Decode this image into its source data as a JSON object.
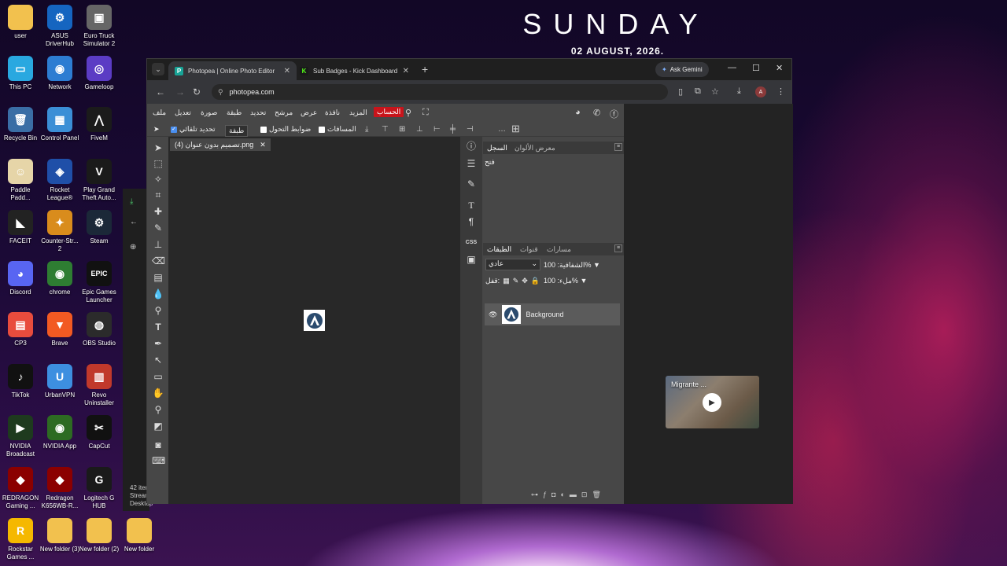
{
  "desktop": {
    "clock": {
      "day": "SUNDAY",
      "date": "02 AUGUST, 2026."
    },
    "icons": [
      {
        "label": "user",
        "color": "#f2c14e",
        "glyph": ""
      },
      {
        "label": "ASUS DriverHub",
        "color": "#1565c0",
        "glyph": "⚙"
      },
      {
        "label": "Euro Truck Simulator 2",
        "color": "#666666",
        "glyph": "▣"
      },
      {
        "label": "This PC",
        "color": "#29a8e0",
        "glyph": "▭"
      },
      {
        "label": "Network",
        "color": "#2d7dd2",
        "glyph": "◉"
      },
      {
        "label": "Gameloop",
        "color": "#5b3cc4",
        "glyph": "◎"
      },
      {
        "label": "Recycle Bin",
        "color": "#3a6ea5",
        "glyph": "🗑"
      },
      {
        "label": "Control Panel",
        "color": "#3b8fd6",
        "glyph": "▦"
      },
      {
        "label": "FiveM",
        "color": "#1b1b1b",
        "glyph": "⋀"
      },
      {
        "label": "Paddle Padd...",
        "color": "#e6d5a8",
        "glyph": "☺"
      },
      {
        "label": "Rocket League®",
        "color": "#1f4fa8",
        "glyph": "◈"
      },
      {
        "label": "Play Grand Theft Auto...",
        "color": "#1a1a1a",
        "glyph": "V"
      },
      {
        "label": "FACEIT",
        "color": "#222222",
        "glyph": "◣"
      },
      {
        "label": "Counter-Str... 2",
        "color": "#d98c1c",
        "glyph": "✦"
      },
      {
        "label": "Steam",
        "color": "#1b2838",
        "glyph": "⚙"
      },
      {
        "label": "Discord",
        "color": "#5865f2",
        "glyph": "◕"
      },
      {
        "label": "chrome",
        "color": "#2e7d32",
        "glyph": "◉"
      },
      {
        "label": "Epic Games Launcher",
        "color": "#111111",
        "glyph": "EPIC"
      },
      {
        "label": "CP3",
        "color": "#e84c3d",
        "glyph": "▤"
      },
      {
        "label": "Brave",
        "color": "#f25a22",
        "glyph": "▼"
      },
      {
        "label": "OBS Studio",
        "color": "#2b2b2b",
        "glyph": "◍"
      },
      {
        "label": "TikTok",
        "color": "#111111",
        "glyph": "♪"
      },
      {
        "label": "UrbanVPN",
        "color": "#3d8fe0",
        "glyph": "U"
      },
      {
        "label": "Revo Uninstaller",
        "color": "#c0392b",
        "glyph": "▥"
      },
      {
        "label": "NVIDIA Broadcast",
        "color": "#1e3a1e",
        "glyph": "▶"
      },
      {
        "label": "NVIDIA App",
        "color": "#2d6b22",
        "glyph": "◉"
      },
      {
        "label": "CapCut",
        "color": "#111111",
        "glyph": "✂"
      },
      {
        "label": "REDRAGON Gaming ...",
        "color": "#8b0000",
        "glyph": "◆"
      },
      {
        "label": "Redragon K656WB-R...",
        "color": "#8b0000",
        "glyph": "◆"
      },
      {
        "label": "Logitech G HUB",
        "color": "#1a1a1a",
        "glyph": "G"
      },
      {
        "label": "Rockstar Games ...",
        "color": "#f5b800",
        "glyph": "R"
      },
      {
        "label": "New folder (3)",
        "color": "#f2c14e",
        "glyph": ""
      },
      {
        "label": "New folder (2)",
        "color": "#f2c14e",
        "glyph": ""
      },
      {
        "label": "New folder",
        "color": "#f2c14e",
        "glyph": ""
      }
    ]
  },
  "explorer_fragment": {
    "item_count": "42 iter",
    "path1": "Stream",
    "path2": "Desktop"
  },
  "browser": {
    "tabs": [
      {
        "title": "Photopea | Online Photo Editor",
        "active": true,
        "favicon_color": "#18a497"
      },
      {
        "title": "Sub Badges - Kick Dashboard",
        "active": false,
        "favicon_color": "#53fc18"
      }
    ],
    "ask_gemini": "Ask Gemini",
    "url": "photopea.com"
  },
  "photopea": {
    "menu": [
      "ملف",
      "تعديل",
      "صورة",
      "طبقة",
      "تحديد",
      "مرشح",
      "عرض",
      "نافذة",
      "المزيد"
    ],
    "account": "الحساب",
    "options": {
      "auto_select": "تحديد تلقائي",
      "layer_dropdown": "طبقة",
      "transform_controls": "ضوابط التحول",
      "distances": "المسافات"
    },
    "document_tab": "(4) تصميم بدون عنوان.png",
    "history_panel": {
      "tabs": [
        "السجل",
        "معرض الألوان"
      ],
      "entries": [
        "فتح"
      ]
    },
    "layers_panel": {
      "tabs": [
        "الطبقات",
        "قنوات",
        "مسارات"
      ],
      "blend_mode": "عادي",
      "opacity_label": "الشفافية:",
      "opacity_value": "100%",
      "lock_label": "قفل:",
      "fill_label": "ملء:",
      "fill_value": "100%",
      "layers": [
        {
          "name": "Background",
          "visible": true
        }
      ]
    },
    "strip_css_label": "CSS"
  },
  "video_popup": {
    "title": "Migrante ..."
  }
}
